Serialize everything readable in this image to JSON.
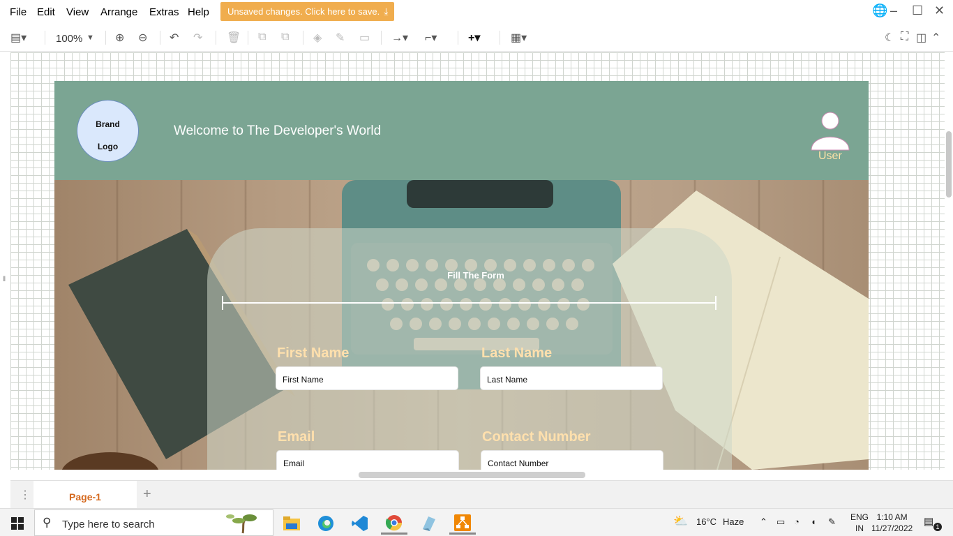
{
  "menu": {
    "items": [
      "File",
      "Edit",
      "View",
      "Arrange",
      "Extras",
      "Help"
    ],
    "save_banner": "Unsaved changes. Click here to save."
  },
  "toolbar": {
    "zoom": "100%"
  },
  "mockup": {
    "brand_line1": "Brand",
    "brand_line2": "Logo",
    "welcome": "Welcome to The Developer's World",
    "user_label": "User",
    "form_title": "Fill The Form",
    "fields": [
      {
        "label": "First Name",
        "value": "First Name"
      },
      {
        "label": "Last Name",
        "value": "Last Name"
      },
      {
        "label": "Email",
        "value": "Email"
      },
      {
        "label": "Contact Number",
        "value": "Contact Number"
      }
    ]
  },
  "pages": {
    "active": "Page-1"
  },
  "taskbar": {
    "search_placeholder": "Type here to search",
    "weather_temp": "16°C",
    "weather_desc": "Haze",
    "lang_line1": "ENG",
    "lang_line2": "IN",
    "time": "1:10 AM",
    "date": "11/27/2022",
    "notification_count": "1"
  },
  "colors": {
    "header_bg": "#7ba593",
    "save_banner_bg": "#f0ad4e",
    "field_label": "#ffe0ad",
    "page_tab_text": "#d5691e"
  },
  "icons": {
    "toolbar": [
      "format-panel-icon",
      "zoom-in-icon",
      "zoom-out-icon",
      "undo-icon",
      "redo-icon",
      "delete-icon",
      "to-front-icon",
      "to-back-icon",
      "fill-color-icon",
      "line-color-icon",
      "shadow-icon",
      "connection-icon",
      "waypoints-icon",
      "insert-icon",
      "table-icon",
      "dark-mode-icon",
      "fullscreen-icon",
      "sidebar-toggle-icon"
    ]
  }
}
